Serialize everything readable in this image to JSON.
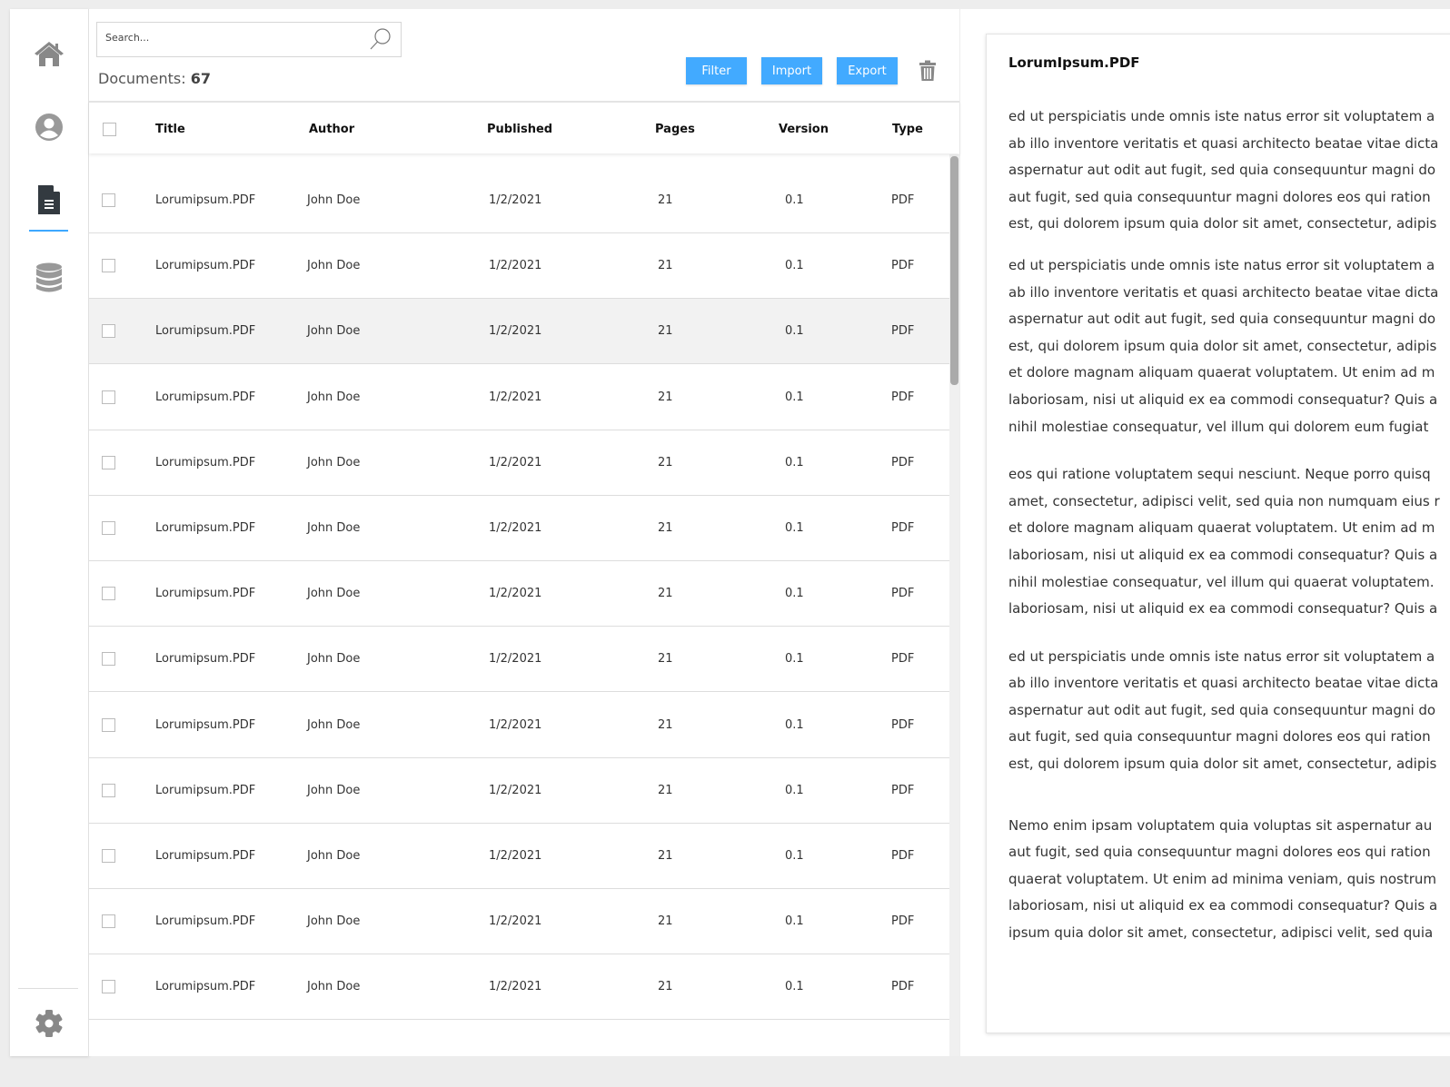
{
  "sidebar": {
    "items": [
      {
        "icon": "home-icon"
      },
      {
        "icon": "user-icon"
      },
      {
        "icon": "document-icon",
        "active": true
      },
      {
        "icon": "database-icon"
      }
    ],
    "settings_icon": "gear-icon",
    "accent": "#3ea8ff"
  },
  "search": {
    "placeholder": "Search..."
  },
  "summary": {
    "label": "Documents:",
    "count": "67"
  },
  "toolbar": {
    "filter": "Filter",
    "import": "Import",
    "export": "Export",
    "button_color": "#42aaff"
  },
  "table": {
    "columns": [
      "Title",
      "Author",
      "Published",
      "Pages",
      "Version",
      "Type"
    ],
    "rows": [
      [
        "Lorumipsum.PDF",
        "John Doe",
        "1/2/2021",
        "21",
        "0.1",
        "PDF"
      ],
      [
        "Lorumipsum.PDF",
        "John Doe",
        "1/2/2021",
        "21",
        "0.1",
        "PDF"
      ],
      [
        "Lorumipsum.PDF",
        "John Doe",
        "1/2/2021",
        "21",
        "0.1",
        "PDF"
      ],
      [
        "Lorumipsum.PDF",
        "John Doe",
        "1/2/2021",
        "21",
        "0.1",
        "PDF"
      ],
      [
        "Lorumipsum.PDF",
        "John Doe",
        "1/2/2021",
        "21",
        "0.1",
        "PDF"
      ],
      [
        "Lorumipsum.PDF",
        "John Doe",
        "1/2/2021",
        "21",
        "0.1",
        "PDF"
      ],
      [
        "Lorumipsum.PDF",
        "John Doe",
        "1/2/2021",
        "21",
        "0.1",
        "PDF"
      ],
      [
        "Lorumipsum.PDF",
        "John Doe",
        "1/2/2021",
        "21",
        "0.1",
        "PDF"
      ],
      [
        "Lorumipsum.PDF",
        "John Doe",
        "1/2/2021",
        "21",
        "0.1",
        "PDF"
      ],
      [
        "Lorumipsum.PDF",
        "John Doe",
        "1/2/2021",
        "21",
        "0.1",
        "PDF"
      ],
      [
        "Lorumipsum.PDF",
        "John Doe",
        "1/2/2021",
        "21",
        "0.1",
        "PDF"
      ],
      [
        "Lorumipsum.PDF",
        "John Doe",
        "1/2/2021",
        "21",
        "0.1",
        "PDF"
      ],
      [
        "Lorumipsum.PDF",
        "John Doe",
        "1/2/2021",
        "21",
        "0.1",
        "PDF"
      ]
    ],
    "highlighted_row": 2
  },
  "preview": {
    "title": "LorumIpsum.PDF",
    "paragraphs": [
      [
        "ed ut perspiciatis unde omnis iste natus error sit voluptatem a",
        "ab illo inventore veritatis et quasi architecto beatae vitae dicta",
        "aspernatur aut odit aut fugit, sed quia consequuntur magni do",
        "aut fugit, sed quia consequuntur magni dolores eos qui ration",
        "est, qui dolorem ipsum quia dolor sit amet, consectetur, adipis"
      ],
      [
        "ed ut perspiciatis unde omnis iste natus error sit voluptatem a",
        "ab illo inventore veritatis et quasi architecto beatae vitae dicta",
        "aspernatur aut odit aut fugit, sed quia consequuntur magni do",
        "est, qui dolorem ipsum quia dolor sit amet, consectetur, adipis",
        "et dolore magnam aliquam quaerat voluptatem. Ut enim ad m",
        "laboriosam, nisi ut aliquid ex ea commodi consequatur? Quis a",
        "nihil molestiae consequatur, vel illum qui dolorem eum fugiat"
      ],
      [
        "eos qui ratione voluptatem sequi nesciunt. Neque porro quisq",
        "amet, consectetur, adipisci velit, sed quia non numquam eius r",
        "et dolore magnam aliquam quaerat voluptatem. Ut enim ad m",
        "laboriosam, nisi ut aliquid ex ea commodi consequatur? Quis a",
        "nihil molestiae consequatur, vel illum qui quaerat voluptatem.",
        "laboriosam, nisi ut aliquid ex ea commodi consequatur? Quis a"
      ],
      [
        "ed ut perspiciatis unde omnis iste natus error sit voluptatem a",
        "ab illo inventore veritatis et quasi architecto beatae vitae dicta",
        "aspernatur aut odit aut fugit, sed quia consequuntur magni do",
        "aut fugit, sed quia consequuntur magni dolores eos qui ration",
        "est, qui dolorem ipsum quia dolor sit amet, consectetur, adipis"
      ],
      [
        "Nemo enim ipsam voluptatem quia voluptas sit  aspernatur au",
        "aut fugit, sed quia consequuntur magni dolores eos qui ration",
        "quaerat voluptatem. Ut enim ad minima veniam, quis nostrum",
        "laboriosam, nisi ut aliquid ex ea commodi consequatur? Quis a",
        "ipsum quia dolor sit amet, consectetur, adipisci velit, sed quia"
      ]
    ]
  }
}
